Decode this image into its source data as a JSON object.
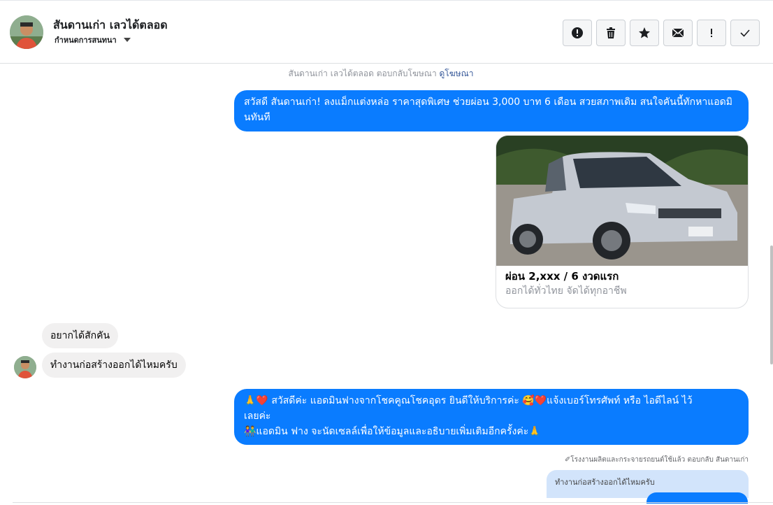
{
  "header": {
    "contact_name": "สันดานเก่า เลวได้ตลอด",
    "label_menu": "กำหนดการสนทนา",
    "actions": [
      {
        "name": "mark-spam-button",
        "icon": "alert-circle-icon"
      },
      {
        "name": "delete-button",
        "icon": "trash-icon"
      },
      {
        "name": "star-button",
        "icon": "star-icon"
      },
      {
        "name": "mark-unread-button",
        "icon": "envelope-icon"
      },
      {
        "name": "report-button",
        "icon": "exclamation-icon"
      },
      {
        "name": "mark-done-button",
        "icon": "check-icon"
      }
    ]
  },
  "thread": {
    "ad_reference": {
      "text": "สันดานเก่า เลวได้ตลอด ตอบกลับโฆษณา",
      "link": "ดูโฆษณา"
    },
    "outgoing_1": "สวัสดี สันดานเก่า! ลงแม็กแต่งหล่อ ราคาสุดพิเศษ ช่วยผ่อน 3,000 บาท 6 เดือน สวยสภาพเดิม สนใจคันนี้ทักหาแอดมินทันที",
    "ad_card": {
      "title": "ผ่อน 2,xxx / 6 งวดแรก",
      "subtitle": "ออกได้ทั่วไทย จัดได้ทุกอาชีพ"
    },
    "incoming_1": "อยากได้สักคัน",
    "incoming_2": "ทำงานก่อสร้างออกได้ไหมครับ",
    "outgoing_2": {
      "line1": "🙏❤️ สวัสดีค่ะ แอดมินฟางจากโชคคูณโชคอุดร ยินดีให้บริการค่ะ 🥰❤️แจ้งเบอร์โทรศัพท์ หรือ ไอดีไลน์ ไว้",
      "line2": "เลยค่ะ",
      "line3": "👫แอดมิน ฟาง จะนัดเซลล์เพื่อให้ข้อมูลและอธิบายเพิ่มเติมอีกครั้งค่ะ🙏"
    },
    "reply_meta": "✐โรงงานผลิตและกระจายรถยนต์ใช้แล้ว ตอบกลับ สันดานเก่า",
    "reply_quote": "ทำงานก่อสร้างออกได้ไหมครับ"
  },
  "colors": {
    "outgoing_bubble": "#0a7cff",
    "incoming_bubble": "#f1f0f0",
    "reply_quote_bg": "#d2e4fb"
  }
}
